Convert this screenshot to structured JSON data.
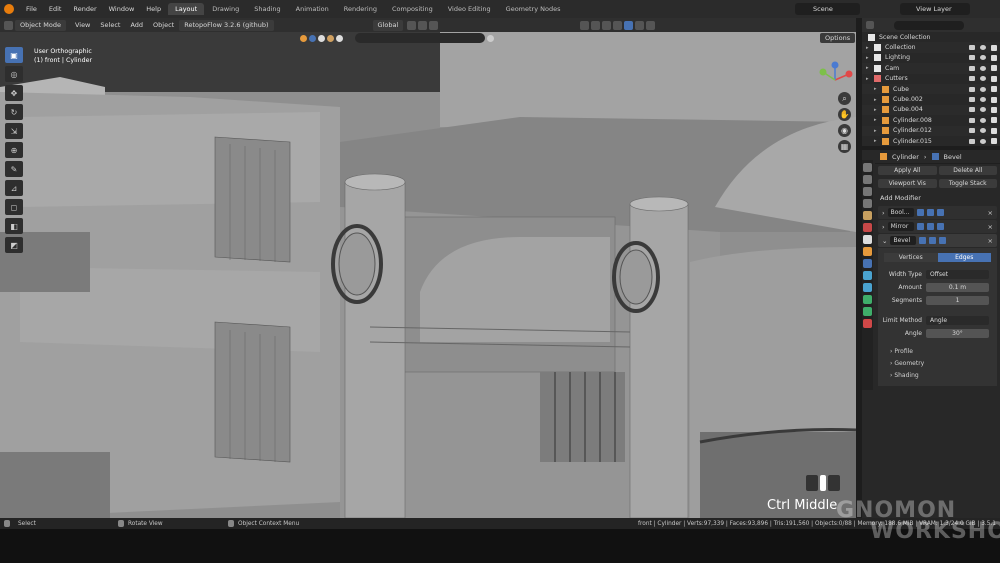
{
  "menubar": {
    "menus": [
      "File",
      "Edit",
      "Render",
      "Window",
      "Help"
    ],
    "workspaces": [
      "Layout",
      "Drawing",
      "Shading",
      "Animation",
      "Rendering",
      "Compositing",
      "Video Editing",
      "Geometry Nodes"
    ],
    "active_workspace": "Layout",
    "scene": "Scene",
    "view_layer": "View Layer"
  },
  "viewport_header": {
    "mode": "Object Mode",
    "menus": [
      "View",
      "Select",
      "Add",
      "Object"
    ],
    "addon": "RetopoFlow 3.2.6 (github)",
    "transform_orientation": "Global",
    "options": "Options"
  },
  "viewport": {
    "view_name": "User Orthographic",
    "object_info": "(1) front | Cylinder",
    "key_hint": "Ctrl Middle"
  },
  "outliner": {
    "root": "Scene Collection",
    "rows": [
      {
        "label": "Collection",
        "icon_color": "#e8e8e8",
        "selected": false
      },
      {
        "label": "Lighting",
        "icon_color": "#e8e8e8",
        "selected": false
      },
      {
        "label": "Cam",
        "icon_color": "#e8e8e8",
        "selected": false
      },
      {
        "label": "Cutters",
        "icon_color": "#e06a6a",
        "selected": false
      },
      {
        "label": "Cube",
        "icon_color": "#e69a3c",
        "selected": false
      },
      {
        "label": "Cube.002",
        "icon_color": "#e69a3c",
        "selected": false
      },
      {
        "label": "Cube.004",
        "icon_color": "#e69a3c",
        "selected": false
      },
      {
        "label": "Cylinder.008",
        "icon_color": "#e69a3c",
        "selected": false
      },
      {
        "label": "Cylinder.012",
        "icon_color": "#e69a3c",
        "selected": false
      },
      {
        "label": "Cylinder.015",
        "icon_color": "#e69a3c",
        "selected": false
      }
    ]
  },
  "properties": {
    "object": "Cylinder",
    "modifier_path": "Bevel",
    "apply_all": "Apply All",
    "delete_all": "Delete All",
    "viewport_vis": "Viewport Vis",
    "toggle_stack": "Toggle Stack",
    "add_modifier": "Add Modifier",
    "modifiers": [
      {
        "name": "Bool..."
      },
      {
        "name": "Mirror"
      },
      {
        "name": "Bevel"
      }
    ],
    "bevel": {
      "affect_options": [
        "Vertices",
        "Edges"
      ],
      "affect_selected": "Edges",
      "width_type_label": "Width Type",
      "width_type": "Offset",
      "amount_label": "Amount",
      "amount": "0.1 m",
      "segments_label": "Segments",
      "segments": "1",
      "limit_method_label": "Limit Method",
      "limit_method": "Angle",
      "angle_label": "Angle",
      "angle": "30°",
      "subpanels": [
        "Profile",
        "Geometry",
        "Shading"
      ]
    }
  },
  "statusbar": {
    "select": "Select",
    "rotate": "Rotate View",
    "context": "Object Context Menu",
    "stats": "front | Cylinder | Verts:97,339 | Faces:93,896 | Tris:191,560 | Objects:0/88 | Memory: 188.6 MiB | VRAM: 1.3/24.0 GiB | 3.5.1"
  },
  "watermark": {
    "line1": "GNOMON",
    "line2": "WORKSHOP"
  },
  "colors": {
    "accent": "#4772b3",
    "blender_orange": "#e87d0d",
    "viewport_bg": "#8c8c8c"
  }
}
